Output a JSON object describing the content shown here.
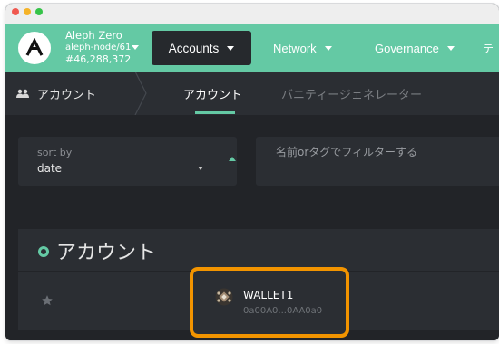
{
  "chain": {
    "name": "Aleph Zero",
    "node": "aleph-node/61",
    "block": "#46,288,372"
  },
  "menu": {
    "accounts": "Accounts",
    "network": "Network",
    "governance": "Governance",
    "more": "テ"
  },
  "subnav": {
    "section": "アカウント",
    "tabs": [
      "アカウント",
      "バニティージェネレーター"
    ]
  },
  "sort": {
    "label": "sort by",
    "value": "date"
  },
  "filter": {
    "placeholder": "名前orタグでフィルターする"
  },
  "accounts_section": {
    "title": "アカウント"
  },
  "account": {
    "name": "WALLET1",
    "address": "0a00A0...0AA0a0"
  },
  "colors": {
    "accent": "#64c9a4",
    "highlight": "#f29400",
    "background": "#222428",
    "panel": "#2b2e33"
  },
  "icons": {
    "logo": "aleph-zero-logo",
    "people": "people-icon",
    "star": "star-icon",
    "identicon": "account-identicon"
  }
}
